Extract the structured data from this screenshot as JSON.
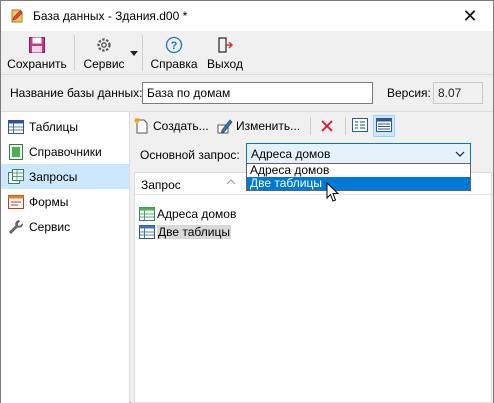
{
  "window": {
    "title": "База данных - Здания.d00 *"
  },
  "toolbar": {
    "save": "Сохранить",
    "service": "Сервис",
    "help": "Справка",
    "exit": "Выход"
  },
  "db": {
    "name_label": "Название базы данных:",
    "name_value": "База по домам",
    "version_label": "Версия:",
    "version_value": "8.07"
  },
  "nav": {
    "items": [
      {
        "label": "Таблицы",
        "icon": "table-icon"
      },
      {
        "label": "Справочники",
        "icon": "directory-icon"
      },
      {
        "label": "Запросы",
        "icon": "query-icon",
        "selected": true
      },
      {
        "label": "Формы",
        "icon": "form-icon"
      },
      {
        "label": "Сервис",
        "icon": "wrench-icon"
      }
    ]
  },
  "content": {
    "create": "Создать...",
    "edit": "Изменить...",
    "main_query_label": "Основной запрос:",
    "main_query_value": "Адреса домов",
    "column_header": "Запрос",
    "rows": [
      {
        "label": "Адреса домов",
        "icon": "query-green-icon"
      },
      {
        "label": "Две таблицы",
        "icon": "query-blue-icon",
        "selected": true
      }
    ],
    "dropdown_options": [
      {
        "label": "Адреса домов"
      },
      {
        "label": "Две таблицы",
        "highlighted": true
      }
    ]
  },
  "colors": {
    "accent": "#0078d7",
    "selection": "#cce8ff",
    "delete": "#e81123"
  }
}
